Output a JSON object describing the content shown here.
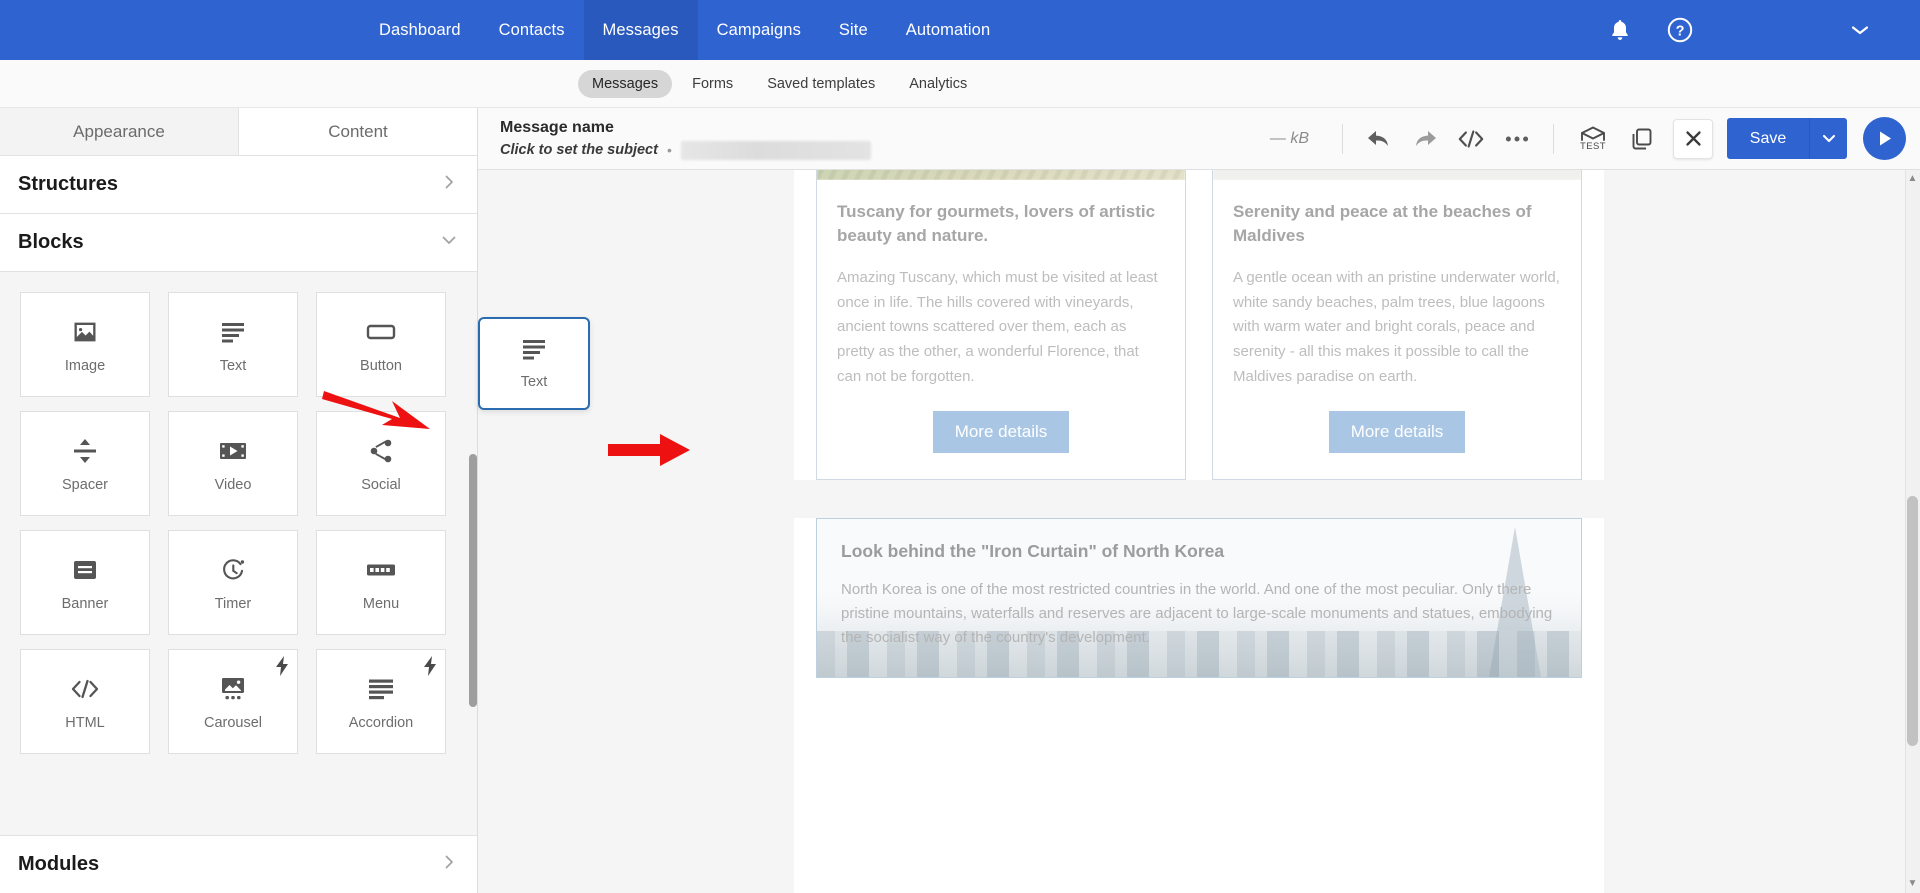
{
  "topnav": {
    "items": [
      {
        "label": "Dashboard",
        "active": false
      },
      {
        "label": "Contacts",
        "active": false
      },
      {
        "label": "Messages",
        "active": true
      },
      {
        "label": "Campaigns",
        "active": false
      },
      {
        "label": "Site",
        "active": false
      },
      {
        "label": "Automation",
        "active": false
      }
    ],
    "icons": [
      "bell-icon",
      "help-icon",
      "chevron-down-icon"
    ],
    "background_color": "#2f63d0",
    "active_color": "#2a59be"
  },
  "subnav": {
    "items": [
      {
        "label": "Messages",
        "active": true
      },
      {
        "label": "Forms",
        "active": false
      },
      {
        "label": "Saved templates",
        "active": false
      },
      {
        "label": "Analytics",
        "active": false
      }
    ]
  },
  "left_panel": {
    "tabs": [
      {
        "label": "Appearance",
        "active": true
      },
      {
        "label": "Content",
        "active": false
      }
    ],
    "sections": {
      "structures": {
        "label": "Structures",
        "state": "collapsed",
        "icon": "chevron-right-icon"
      },
      "blocks": {
        "label": "Blocks",
        "state": "expanded",
        "icon": "chevron-down-icon"
      },
      "modules": {
        "label": "Modules",
        "state": "collapsed",
        "icon": "chevron-right-icon"
      }
    },
    "blocks": [
      {
        "label": "Image",
        "icon": "image-icon",
        "premium": false
      },
      {
        "label": "Text",
        "icon": "text-lines-icon",
        "premium": false
      },
      {
        "label": "Button",
        "icon": "button-icon",
        "premium": false
      },
      {
        "label": "Spacer",
        "icon": "spacer-icon",
        "premium": false
      },
      {
        "label": "Video",
        "icon": "video-icon",
        "premium": false
      },
      {
        "label": "Social",
        "icon": "share-icon",
        "premium": false
      },
      {
        "label": "Banner",
        "icon": "banner-icon",
        "premium": false
      },
      {
        "label": "Timer",
        "icon": "timer-icon",
        "premium": false
      },
      {
        "label": "Menu",
        "icon": "menu-icon",
        "premium": false
      },
      {
        "label": "HTML",
        "icon": "code-icon",
        "premium": false
      },
      {
        "label": "Carousel",
        "icon": "carousel-icon",
        "premium": true
      },
      {
        "label": "Accordion",
        "icon": "accordion-icon",
        "premium": true
      }
    ]
  },
  "drag_ghost": {
    "label": "Text",
    "icon": "text-lines-icon"
  },
  "editor_header": {
    "message_name": "Message name",
    "subject_placeholder": "Click to set the subject",
    "separator_dot": "•",
    "size_label": "— kB",
    "tools": [
      {
        "name": "undo-icon",
        "label": "Undo"
      },
      {
        "name": "redo-icon",
        "label": "Redo"
      },
      {
        "name": "code-icon",
        "label": "Source code"
      },
      {
        "name": "more-icon",
        "label": "More"
      }
    ],
    "test_label": "TEST",
    "copy_icon": "duplicate-icon",
    "close_icon": "close-icon",
    "save_label": "Save",
    "save_caret_icon": "chevron-down-icon",
    "play_icon": "play-icon",
    "accent_color": "#2f63d0"
  },
  "email_canvas": {
    "columns": [
      {
        "image": "tuscany-vineyards-photo",
        "title": "Tuscany for gourmets, lovers of artistic beauty and nature.",
        "body": "Amazing Tuscany, which must be visited at least once in life. The hills covered with vineyards, ancient towns scattered over them, each as pretty as the other, a wonderful Florence, that can not be forgotten.",
        "button": "More details"
      },
      {
        "image": "maldives-beach-photo",
        "title": "Serenity and peace at the beaches of Maldives",
        "body": "A gentle ocean with an pristine underwater world, white sandy beaches, palm trees, blue lagoons with warm water and bright corals, peace and serenity - all this makes it possible to call the Maldives paradise on earth.",
        "button": "More details"
      }
    ],
    "feature_block": {
      "image": "north-korea-skyline-photo",
      "title": "Look behind the \"Iron Curtain\" of North Korea",
      "body": "North Korea is one of the most restricted countries in the world. And one of the most peculiar. Only there pristine mountains, waterfalls and reserves are adjacent to large-scale monuments and statues, embodying the socialist way of the country's development."
    }
  },
  "annotations": {
    "arrow_1": "red-arrow-pointing-to-button-block",
    "arrow_2": "red-arrow-pointing-to-canvas",
    "arrow_color": "#ee1111"
  }
}
